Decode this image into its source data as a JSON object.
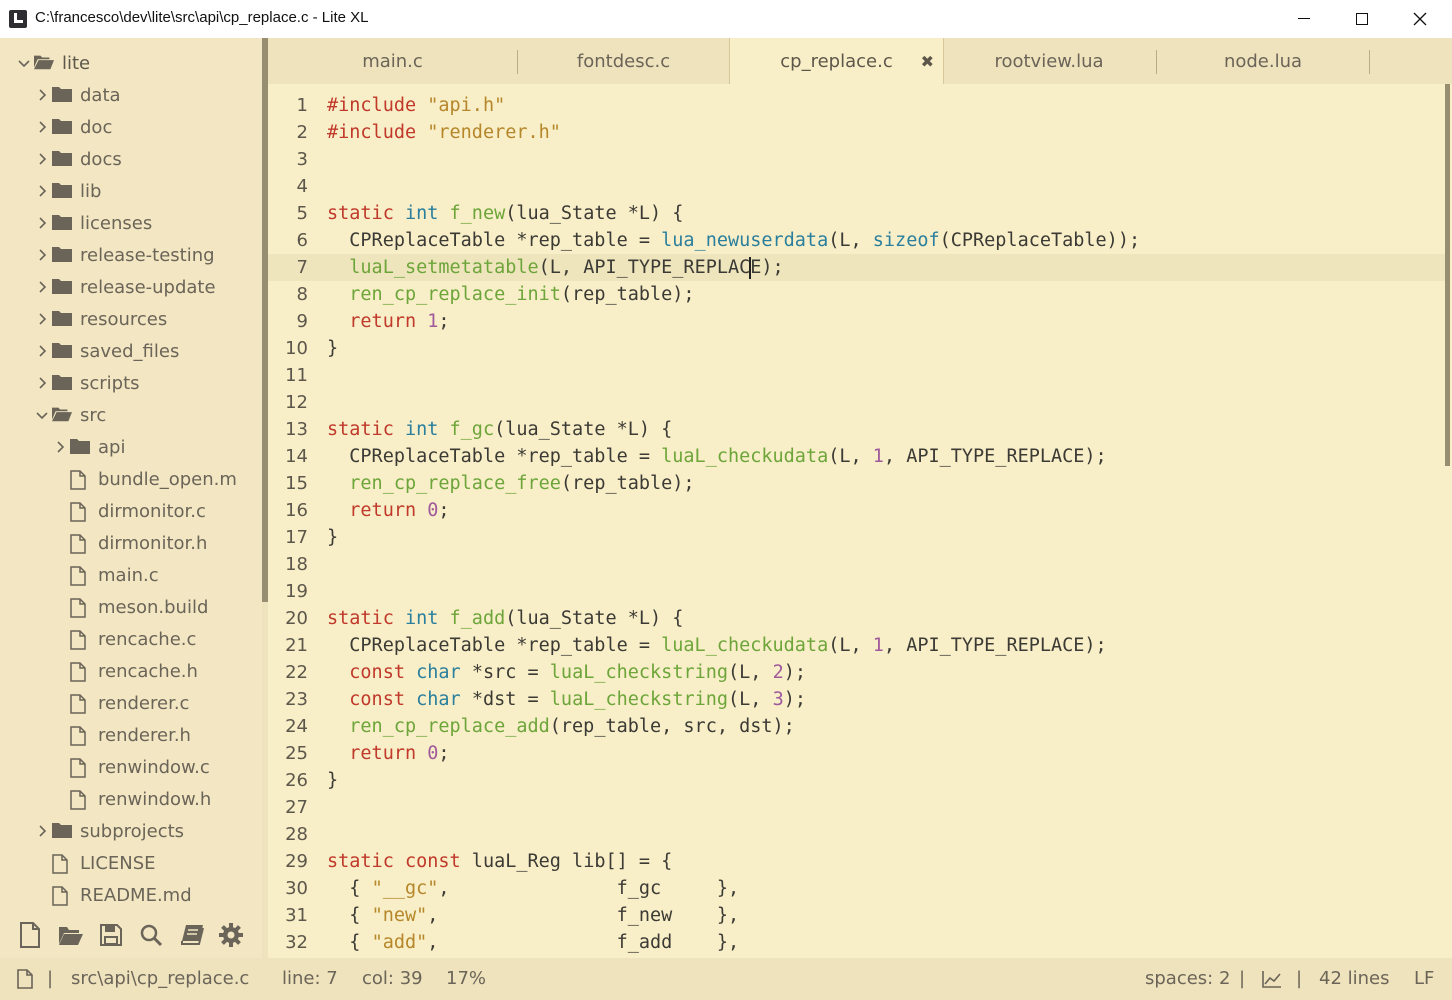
{
  "window": {
    "title": "C:\\francesco\\dev\\lite\\src\\api\\cp_replace.c - Lite XL"
  },
  "sidebar": {
    "items": [
      {
        "label": "lite",
        "kind": "folder-open",
        "expanded": true,
        "depth": 0
      },
      {
        "label": "data",
        "kind": "folder",
        "depth": 1
      },
      {
        "label": "doc",
        "kind": "folder",
        "depth": 1
      },
      {
        "label": "docs",
        "kind": "folder",
        "depth": 1
      },
      {
        "label": "lib",
        "kind": "folder",
        "depth": 1
      },
      {
        "label": "licenses",
        "kind": "folder",
        "depth": 1
      },
      {
        "label": "release-testing",
        "kind": "folder",
        "depth": 1
      },
      {
        "label": "release-update",
        "kind": "folder",
        "depth": 1
      },
      {
        "label": "resources",
        "kind": "folder",
        "depth": 1
      },
      {
        "label": "saved_files",
        "kind": "folder",
        "depth": 1
      },
      {
        "label": "scripts",
        "kind": "folder",
        "depth": 1
      },
      {
        "label": "src",
        "kind": "folder-open",
        "expanded": true,
        "depth": 1
      },
      {
        "label": "api",
        "kind": "folder",
        "depth": 2
      },
      {
        "label": "bundle_open.m",
        "kind": "file",
        "depth": 2
      },
      {
        "label": "dirmonitor.c",
        "kind": "file",
        "depth": 2
      },
      {
        "label": "dirmonitor.h",
        "kind": "file",
        "depth": 2
      },
      {
        "label": "main.c",
        "kind": "file",
        "depth": 2
      },
      {
        "label": "meson.build",
        "kind": "file",
        "depth": 2
      },
      {
        "label": "rencache.c",
        "kind": "file",
        "depth": 2
      },
      {
        "label": "rencache.h",
        "kind": "file",
        "depth": 2
      },
      {
        "label": "renderer.c",
        "kind": "file",
        "depth": 2
      },
      {
        "label": "renderer.h",
        "kind": "file",
        "depth": 2
      },
      {
        "label": "renwindow.c",
        "kind": "file",
        "depth": 2
      },
      {
        "label": "renwindow.h",
        "kind": "file",
        "depth": 2
      },
      {
        "label": "subprojects",
        "kind": "folder",
        "depth": 1
      },
      {
        "label": "LICENSE",
        "kind": "file",
        "depth": 1
      },
      {
        "label": "README.md",
        "kind": "file",
        "depth": 1
      }
    ],
    "toolbar": [
      "new-file-icon",
      "open-folder-icon",
      "save-icon",
      "find-icon",
      "book-icon",
      "settings-icon"
    ]
  },
  "tabs": [
    {
      "label": "main.c",
      "active": false
    },
    {
      "label": "fontdesc.c",
      "active": false
    },
    {
      "label": "cp_replace.c",
      "active": true,
      "close": "✖"
    },
    {
      "label": "rootview.lua",
      "active": false
    },
    {
      "label": "node.lua",
      "active": false
    }
  ],
  "editor": {
    "current_line": 7,
    "lines": [
      {
        "n": "1",
        "tokens": [
          [
            "k",
            "#include"
          ],
          [
            "p",
            " "
          ],
          [
            "s",
            "\"api.h\""
          ]
        ]
      },
      {
        "n": "2",
        "tokens": [
          [
            "k",
            "#include"
          ],
          [
            "p",
            " "
          ],
          [
            "s",
            "\"renderer.h\""
          ]
        ]
      },
      {
        "n": "3",
        "tokens": []
      },
      {
        "n": "4",
        "tokens": []
      },
      {
        "n": "5",
        "tokens": [
          [
            "k",
            "static"
          ],
          [
            "p",
            " "
          ],
          [
            "t",
            "int"
          ],
          [
            "p",
            " "
          ],
          [
            "f",
            "f_new"
          ],
          [
            "p",
            "(lua_State *L) {"
          ]
        ]
      },
      {
        "n": "6",
        "tokens": [
          [
            "p",
            "  CPReplaceTable *rep_table = "
          ],
          [
            "t",
            "lua_newuserdata"
          ],
          [
            "p",
            "(L, "
          ],
          [
            "t",
            "sizeof"
          ],
          [
            "p",
            "(CPReplaceTable));"
          ]
        ]
      },
      {
        "n": "7",
        "tokens": [
          [
            "p",
            "  "
          ],
          [
            "f",
            "luaL_setmetatable"
          ],
          [
            "p",
            "(L, API_TYPE_REPLAC"
          ],
          [
            "cursor",
            ""
          ],
          [
            "p",
            "E);"
          ]
        ]
      },
      {
        "n": "8",
        "tokens": [
          [
            "p",
            "  "
          ],
          [
            "f",
            "ren_cp_replace_init"
          ],
          [
            "p",
            "(rep_table);"
          ]
        ]
      },
      {
        "n": "9",
        "tokens": [
          [
            "p",
            "  "
          ],
          [
            "k",
            "return"
          ],
          [
            "p",
            " "
          ],
          [
            "n",
            "1"
          ],
          [
            "p",
            ";"
          ]
        ]
      },
      {
        "n": "10",
        "tokens": [
          [
            "p",
            "}"
          ]
        ]
      },
      {
        "n": "11",
        "tokens": []
      },
      {
        "n": "12",
        "tokens": []
      },
      {
        "n": "13",
        "tokens": [
          [
            "k",
            "static"
          ],
          [
            "p",
            " "
          ],
          [
            "t",
            "int"
          ],
          [
            "p",
            " "
          ],
          [
            "f",
            "f_gc"
          ],
          [
            "p",
            "(lua_State *L) {"
          ]
        ]
      },
      {
        "n": "14",
        "tokens": [
          [
            "p",
            "  CPReplaceTable *rep_table = "
          ],
          [
            "f",
            "luaL_checkudata"
          ],
          [
            "p",
            "(L, "
          ],
          [
            "n",
            "1"
          ],
          [
            "p",
            ", API_TYPE_REPLACE);"
          ]
        ]
      },
      {
        "n": "15",
        "tokens": [
          [
            "p",
            "  "
          ],
          [
            "f",
            "ren_cp_replace_free"
          ],
          [
            "p",
            "(rep_table);"
          ]
        ]
      },
      {
        "n": "16",
        "tokens": [
          [
            "p",
            "  "
          ],
          [
            "k",
            "return"
          ],
          [
            "p",
            " "
          ],
          [
            "n",
            "0"
          ],
          [
            "p",
            ";"
          ]
        ]
      },
      {
        "n": "17",
        "tokens": [
          [
            "p",
            "}"
          ]
        ]
      },
      {
        "n": "18",
        "tokens": []
      },
      {
        "n": "19",
        "tokens": []
      },
      {
        "n": "20",
        "tokens": [
          [
            "k",
            "static"
          ],
          [
            "p",
            " "
          ],
          [
            "t",
            "int"
          ],
          [
            "p",
            " "
          ],
          [
            "f",
            "f_add"
          ],
          [
            "p",
            "(lua_State *L) {"
          ]
        ]
      },
      {
        "n": "21",
        "tokens": [
          [
            "p",
            "  CPReplaceTable *rep_table = "
          ],
          [
            "f",
            "luaL_checkudata"
          ],
          [
            "p",
            "(L, "
          ],
          [
            "n",
            "1"
          ],
          [
            "p",
            ", API_TYPE_REPLACE);"
          ]
        ]
      },
      {
        "n": "22",
        "tokens": [
          [
            "p",
            "  "
          ],
          [
            "k",
            "const"
          ],
          [
            "p",
            " "
          ],
          [
            "t",
            "char"
          ],
          [
            "p",
            " *src = "
          ],
          [
            "f",
            "luaL_checkstring"
          ],
          [
            "p",
            "(L, "
          ],
          [
            "n",
            "2"
          ],
          [
            "p",
            ");"
          ]
        ]
      },
      {
        "n": "23",
        "tokens": [
          [
            "p",
            "  "
          ],
          [
            "k",
            "const"
          ],
          [
            "p",
            " "
          ],
          [
            "t",
            "char"
          ],
          [
            "p",
            " *dst = "
          ],
          [
            "f",
            "luaL_checkstring"
          ],
          [
            "p",
            "(L, "
          ],
          [
            "n",
            "3"
          ],
          [
            "p",
            ");"
          ]
        ]
      },
      {
        "n": "24",
        "tokens": [
          [
            "p",
            "  "
          ],
          [
            "f",
            "ren_cp_replace_add"
          ],
          [
            "p",
            "(rep_table, src, dst);"
          ]
        ]
      },
      {
        "n": "25",
        "tokens": [
          [
            "p",
            "  "
          ],
          [
            "k",
            "return"
          ],
          [
            "p",
            " "
          ],
          [
            "n",
            "0"
          ],
          [
            "p",
            ";"
          ]
        ]
      },
      {
        "n": "26",
        "tokens": [
          [
            "p",
            "}"
          ]
        ]
      },
      {
        "n": "27",
        "tokens": []
      },
      {
        "n": "28",
        "tokens": []
      },
      {
        "n": "29",
        "tokens": [
          [
            "k",
            "static"
          ],
          [
            "p",
            " "
          ],
          [
            "k",
            "const"
          ],
          [
            "p",
            " luaL_Reg lib[] = {"
          ]
        ]
      },
      {
        "n": "30",
        "tokens": [
          [
            "p",
            "  { "
          ],
          [
            "s",
            "\"__gc\""
          ],
          [
            "p",
            ",               f_gc     },"
          ]
        ]
      },
      {
        "n": "31",
        "tokens": [
          [
            "p",
            "  { "
          ],
          [
            "s",
            "\"new\""
          ],
          [
            "p",
            ",                f_new    },"
          ]
        ]
      },
      {
        "n": "32",
        "tokens": [
          [
            "p",
            "  { "
          ],
          [
            "s",
            "\"add\""
          ],
          [
            "p",
            ",                f_add    },"
          ]
        ]
      }
    ]
  },
  "status": {
    "file_icon": "file-icon",
    "sep": "|",
    "path": "src\\api\\cp_replace.c",
    "line": "line: 7",
    "col": "col: 39",
    "percent": "17%",
    "indent": "spaces: 2",
    "chart_icon": "chart-icon",
    "lines": "42 lines",
    "eol": "LF"
  },
  "colors": {
    "background": "#f8eec7",
    "sidebar": "#f3e7c3",
    "keyword": "#c0392b",
    "type": "#2a7f9e",
    "function": "#6da53a",
    "string": "#b5872a",
    "number": "#a05a9c"
  }
}
